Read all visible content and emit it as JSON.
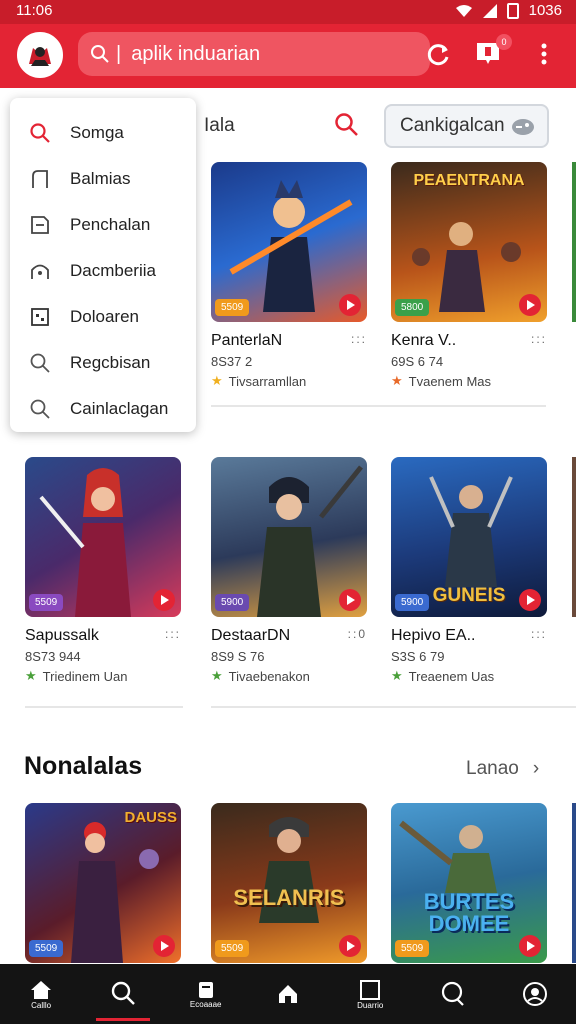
{
  "status_bar": {
    "time": "11:06",
    "right_text": "1036"
  },
  "header": {
    "search_placeholder": "aplik induarian",
    "notification_badge": "0",
    "colors": {
      "primary": "#e32434",
      "dark": "#c81d2a"
    }
  },
  "filter_bar": {
    "label": "Iala",
    "category_button": "Cankigalcan"
  },
  "dropdown": {
    "items": [
      {
        "label": "Somga",
        "icon": "search-icon"
      },
      {
        "label": "Balmias",
        "icon": "bookmark-icon"
      },
      {
        "label": "Penchalan",
        "icon": "store-icon"
      },
      {
        "label": "Dacmberiia",
        "icon": "home-icon"
      },
      {
        "label": "Doloaren",
        "icon": "calendar-icon"
      },
      {
        "label": "Regcbisan",
        "icon": "search-icon"
      },
      {
        "label": "Cainlaclagan",
        "icon": "search-icon"
      }
    ]
  },
  "row1": [
    {
      "name": "PanterlaN",
      "dots": ":::",
      "meta": "8S37 2",
      "rating": "Tivsarramllan",
      "price": "5509",
      "thumb_color": "#2a4fb0",
      "accent": "#e85a2a"
    },
    {
      "name": "Kenra V..",
      "dots": ":::",
      "meta": "69S 6 74",
      "rating": "Tvaenem Mas",
      "price": "5800",
      "thumb_color": "#7a3d1c",
      "accent": "#f0a02c",
      "banner": "PEAENTRANA"
    }
  ],
  "row2": [
    {
      "name": "Sapussalk",
      "dots": ":::",
      "meta": "8S73 944",
      "rating": "Triedinem Uan",
      "price": "5509",
      "thumb_color": "#3a2a6a",
      "accent": "#d83b5a"
    },
    {
      "name": "DestaarDN",
      "dots": "::0",
      "meta": "8S9 S 76",
      "rating": "Tivaebenakon",
      "price": "5900",
      "thumb_color": "#2c3a5a",
      "accent": "#e0a040"
    },
    {
      "name": "Hepivo EA..",
      "dots": ":::",
      "meta": "S3S 6 79",
      "rating": "Treaenem Uas",
      "price": "5900",
      "thumb_color": "#1c3a7a",
      "accent": "#f0c040",
      "banner": "GUNEIS"
    }
  ],
  "section": {
    "title": "Nonalalas",
    "see_all": "Lanao"
  },
  "row3": [
    {
      "price": "5509",
      "thumb_color": "#5a1c2a",
      "accent": "#f0702a",
      "banner": "DAUSS"
    },
    {
      "price": "5509",
      "thumb_color": "#4a2a1c",
      "accent": "#f09a2a",
      "banner": "SELANRIS"
    },
    {
      "price": "5509",
      "thumb_color": "#2a6a9a",
      "accent": "#3a9a4a",
      "banner": "BURTES DOMEE"
    }
  ],
  "bottom_nav": [
    {
      "label": "Calllo",
      "icon": "home-icon"
    },
    {
      "label": "",
      "icon": "search-icon"
    },
    {
      "label": "Ecoaaae",
      "icon": "library-icon"
    },
    {
      "label": "",
      "icon": "house-icon"
    },
    {
      "label": "Duarrio",
      "icon": "square-icon"
    },
    {
      "label": "",
      "icon": "chat-icon"
    },
    {
      "label": "",
      "icon": "profile-icon"
    }
  ]
}
